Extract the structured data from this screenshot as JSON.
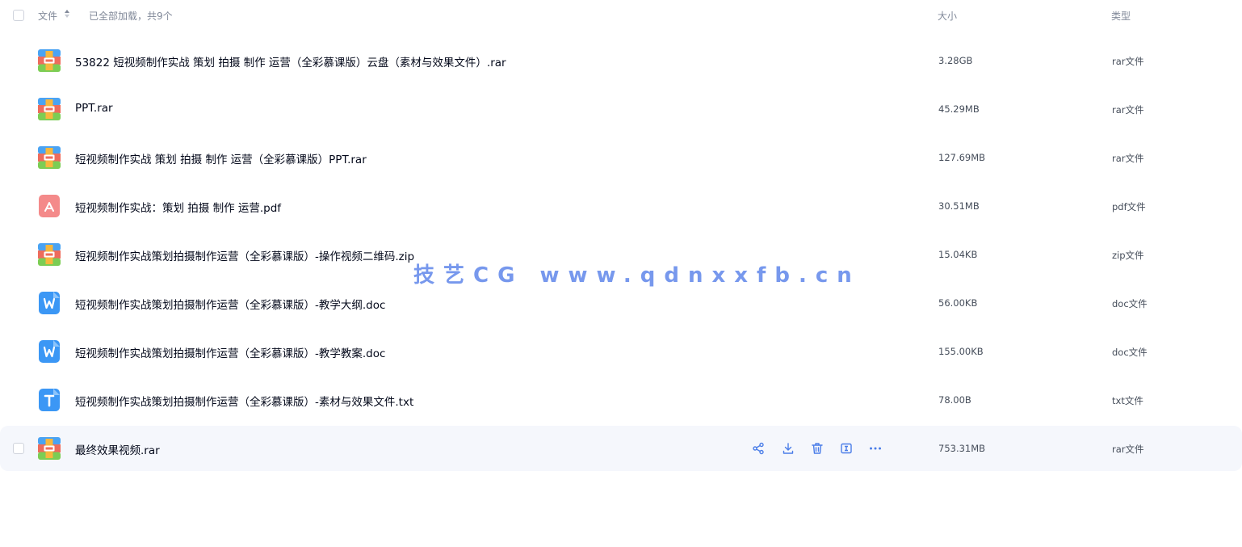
{
  "header": {
    "file_label": "文件",
    "loaded_text": "已全部加载，共9个",
    "size_label": "大小",
    "type_label": "类型"
  },
  "files": [
    {
      "name": "53822 短视频制作实战 策划 拍摄 制作 运营（全彩慕课版）云盘（素材与效果文件）.rar",
      "size": "3.28GB",
      "type": "rar文件",
      "icon": "archive-icon"
    },
    {
      "name": "PPT.rar",
      "size": "45.29MB",
      "type": "rar文件",
      "icon": "archive-icon"
    },
    {
      "name": "短视频制作实战  策划  拍摄  制作  运营（全彩慕课版）PPT.rar",
      "size": "127.69MB",
      "type": "rar文件",
      "icon": "archive-icon"
    },
    {
      "name": "短视频制作实战：策划 拍摄 制作 运营.pdf",
      "size": "30.51MB",
      "type": "pdf文件",
      "icon": "pdf-icon"
    },
    {
      "name": "短视频制作实战策划拍摄制作运营（全彩慕课版）-操作视频二维码.zip",
      "size": "15.04KB",
      "type": "zip文件",
      "icon": "archive-icon"
    },
    {
      "name": "短视频制作实战策划拍摄制作运营（全彩慕课版）-教学大纲.doc",
      "size": "56.00KB",
      "type": "doc文件",
      "icon": "word-doc-icon"
    },
    {
      "name": "短视频制作实战策划拍摄制作运营（全彩慕课版）-教学教案.doc",
      "size": "155.00KB",
      "type": "doc文件",
      "icon": "word-doc-icon"
    },
    {
      "name": "短视频制作实战策划拍摄制作运营（全彩慕课版）-素材与效果文件.txt",
      "size": "78.00B",
      "type": "txt文件",
      "icon": "text-file-icon"
    },
    {
      "name": "最终效果视频.rar",
      "size": "753.31MB",
      "type": "rar文件",
      "icon": "archive-icon",
      "hovered": true
    }
  ],
  "row_actions": [
    "share-icon",
    "download-icon",
    "delete-icon",
    "rename-icon",
    "more-icon"
  ],
  "watermark": "技艺CG www.qdnxxfb.cn",
  "colors": {
    "accent": "#4a7de8",
    "hover_row_bg": "#f5f7fc",
    "muted_text": "#818999"
  }
}
